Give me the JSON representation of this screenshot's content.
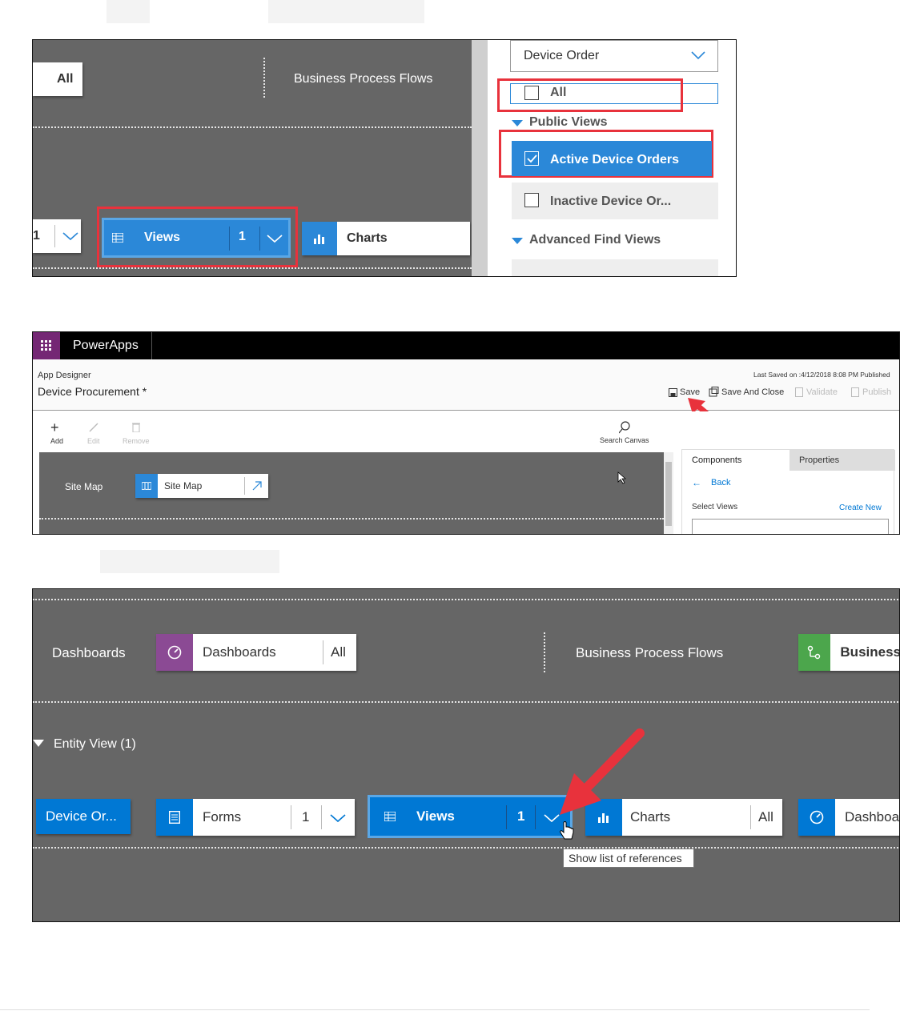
{
  "panel1": {
    "all_tile_label": "All",
    "bpf_label": "Business Process Flows",
    "count_partial": "1",
    "views": {
      "label": "Views",
      "count": "1"
    },
    "charts": {
      "label": "Charts"
    },
    "dropdown_value": "Device Order",
    "all_option": "All",
    "public_views_heading": "Public Views",
    "active_view": "Active Device Orders",
    "inactive_view": "Inactive Device Or...",
    "advanced_heading": "Advanced Find Views",
    "colors": {
      "accent": "#2b88d8",
      "highlight": "#e8323c",
      "canvas": "#666666"
    }
  },
  "panel2": {
    "brand": "PowerApps",
    "app_designer": "App Designer",
    "app_name": "Device Procurement *",
    "last_saved": "Last Saved on :4/12/2018 8:08 PM Published",
    "commands": {
      "save": "Save",
      "save_close": "Save And Close",
      "validate": "Validate",
      "publish": "Publish"
    },
    "toolbar": {
      "add": "Add",
      "edit": "Edit",
      "remove": "Remove",
      "search": "Search Canvas"
    },
    "sitemap_label": "Site Map",
    "sitemap_tile": "Site Map",
    "tabs": {
      "components": "Components",
      "properties": "Properties"
    },
    "back": "Back",
    "select_views": "Select Views",
    "create_new": "Create New"
  },
  "panel3": {
    "dashboards_label": "Dashboards",
    "dashboards_tile": "Dashboards",
    "dashboards_all": "All",
    "bpf_label": "Business Process Flows",
    "bpf_tile": "Business",
    "entity_view": "Entity View (1)",
    "entity_tile": "Device Or...",
    "forms": {
      "label": "Forms",
      "count": "1"
    },
    "views": {
      "label": "Views",
      "count": "1"
    },
    "charts": {
      "label": "Charts",
      "count": "All"
    },
    "dash_partial": "Dashboa",
    "tooltip": "Show list of references",
    "colors": {
      "dashboards_icon": "#8b4a94",
      "bpf_icon": "#4ca64c",
      "accent": "#0078d4"
    }
  }
}
